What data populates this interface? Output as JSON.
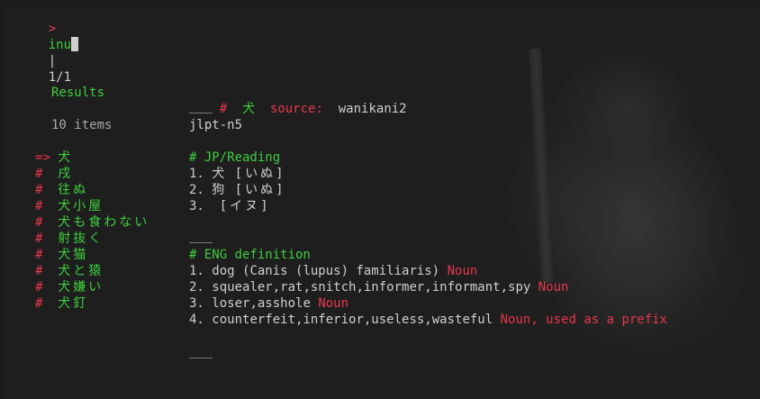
{
  "prompt": {
    "symbol": ">",
    "query": "inu",
    "separator": "|",
    "match_count": "1/1"
  },
  "sidebar": {
    "header": "Results",
    "count": "10 items",
    "items": [
      {
        "marker": "=>",
        "text": "犬"
      },
      {
        "marker": "#",
        "text": "戌"
      },
      {
        "marker": "#",
        "text": "往ぬ"
      },
      {
        "marker": "#",
        "text": "犬小屋"
      },
      {
        "marker": "#",
        "text": "犬も食わない"
      },
      {
        "marker": "#",
        "text": "射抜く"
      },
      {
        "marker": "#",
        "text": "犬猫"
      },
      {
        "marker": "#",
        "text": "犬と猿"
      },
      {
        "marker": "#",
        "text": "犬嫌い"
      },
      {
        "marker": "#",
        "text": "犬釘"
      }
    ]
  },
  "detail": {
    "heading_hash": "#",
    "heading_word": "犬",
    "source_label": "source:",
    "source_value": "wanikani2",
    "tag": "jlpt-n5",
    "reading_heading": "# JP/Reading",
    "readings": [
      {
        "num": "1.",
        "kanji": "犬",
        "reading": "[いぬ]"
      },
      {
        "num": "2.",
        "kanji": "狗",
        "reading": "[いぬ]"
      },
      {
        "num": "3.",
        "kanji": "",
        "reading": "[イヌ]"
      }
    ],
    "eng_heading": "# ENG definition",
    "definitions": [
      {
        "num": "1.",
        "text": "dog (Canis (lupus) familiaris)",
        "pos": "Noun"
      },
      {
        "num": "2.",
        "text": "squealer,rat,snitch,informer,informant,spy",
        "pos": "Noun"
      },
      {
        "num": "3.",
        "text": "loser,asshole",
        "pos": "Noun"
      },
      {
        "num": "4.",
        "text": "counterfeit,inferior,useless,wasteful",
        "pos": "Noun, used as a prefix"
      }
    ]
  },
  "colors": {
    "accent_green": "#3fcf3f",
    "accent_red": "#e6374c",
    "text": "#cfcfcf"
  }
}
